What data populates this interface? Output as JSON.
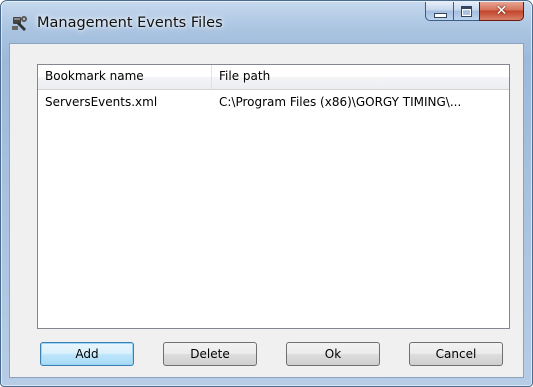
{
  "window": {
    "title": "Management Events Files",
    "icon": "app-tool-icon"
  },
  "caption_buttons": {
    "minimize_icon": "minimize-icon",
    "maximize_icon": "maximize-icon",
    "close_icon": "close-icon",
    "close_glyph": "✕"
  },
  "list": {
    "columns": [
      "Bookmark name",
      "File path"
    ],
    "rows": [
      {
        "name": "ServersEvents.xml",
        "path": "C:\\Program Files (x86)\\GORGY TIMING\\..."
      }
    ]
  },
  "buttons": {
    "add": "Add",
    "delete": "Delete",
    "ok": "Ok",
    "cancel": "Cancel"
  },
  "colors": {
    "titlebar": "#a9c3e1",
    "close_button": "#c2452a",
    "default_button_border": "#3c7fb1",
    "client_background": "#f0f0f0"
  }
}
